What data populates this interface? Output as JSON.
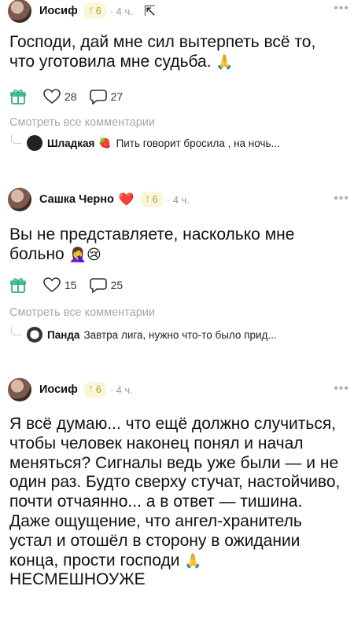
{
  "posts": [
    {
      "username": "Иосиф",
      "badge_level": "6",
      "time": "4 ч.",
      "more_label": "•••",
      "text": "Господи, дай мне сил вытерпеть всё то, что уготовила мне судьба.",
      "emoji": "🙏",
      "likes": "28",
      "comments": "27",
      "see_all": "Смотреть все комментарии",
      "reply_user": "Шладкая",
      "reply_emoji": "🍓",
      "reply_text": "Пить говорит бросила , на ночь..."
    },
    {
      "username": "Сашка Черно",
      "username_emoji": "❤️",
      "badge_level": "6",
      "time": "4 ч.",
      "more_label": "•••",
      "text": "Вы не представляете, насколько мне больно",
      "emoji": "🤦‍♀️😢",
      "likes": "15",
      "comments": "25",
      "see_all": "Смотреть все комментарии",
      "reply_user": "Панда",
      "reply_text": "Завтра лига, нужно что-то было прид..."
    },
    {
      "username": "Иосиф",
      "badge_level": "6",
      "time": "4 ч.",
      "more_label": "•••",
      "text": "Я всё думаю... что ещё должно случиться, чтобы человек наконец понял и начал меняться? Сигналы ведь уже были — и не один раз. Будто сверху стучат, настойчиво, почти отчаянно... а в ответ — тишина. Даже ощущение, что ангел-хранитель устал и отошёл в сторону в ожидании конца, прости господи",
      "emoji": "🙏",
      "text_tail": "НЕСМЕШНОУЖЕ"
    }
  ],
  "icons": {
    "gift": "gift-icon",
    "like": "heart-icon",
    "comment": "comment-icon",
    "badge": "wing-badge-icon"
  },
  "colors": {
    "badge_bg": "#fbf5da",
    "badge_fg": "#b79b35",
    "muted": "#9a9a9a",
    "accent_green": "#2fb37a"
  }
}
